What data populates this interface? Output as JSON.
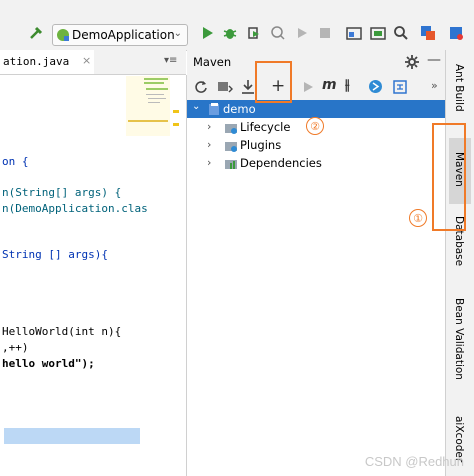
{
  "toolbar": {
    "run_config": "DemoApplication"
  },
  "editor": {
    "tab_label": "ation.java",
    "code_lines": [
      "on {",
      "n(String[] args) {",
      "n(DemoApplication.clas",
      "String [] args){",
      "HelloWorld(int n){",
      ",++)",
      "hello world\");"
    ]
  },
  "maven": {
    "title": "Maven",
    "tree": {
      "root": "demo",
      "children": [
        "Lifecycle",
        "Plugins",
        "Dependencies"
      ]
    }
  },
  "right_stripe": {
    "items": [
      "Ant Build",
      "Maven",
      "Database",
      "Bean Validation",
      "aiXcoder"
    ]
  },
  "annotations": {
    "one": "①",
    "two": "②"
  },
  "watermark": "CSDN @Redhun"
}
